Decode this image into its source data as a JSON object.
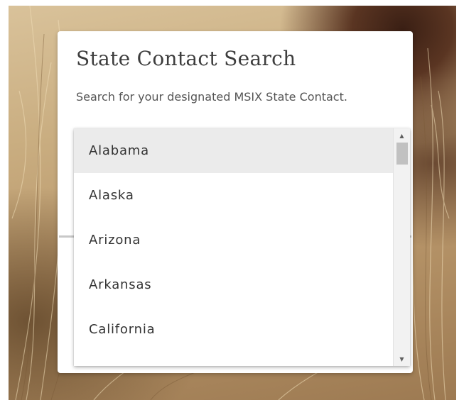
{
  "dialog": {
    "title": "State Contact Search",
    "description": "Search for your designated MSIX State Contact."
  },
  "state_select": {
    "selected_value": "Alabama",
    "options": [
      "Alabama",
      "Alaska",
      "Arizona",
      "Arkansas",
      "California"
    ]
  },
  "scrollbar": {
    "up_icon": "▲",
    "down_icon": "▼"
  },
  "colors": {
    "selected_option_bg": "#ebebeb",
    "title_text": "#3d3d3d",
    "body_text": "#555555"
  }
}
